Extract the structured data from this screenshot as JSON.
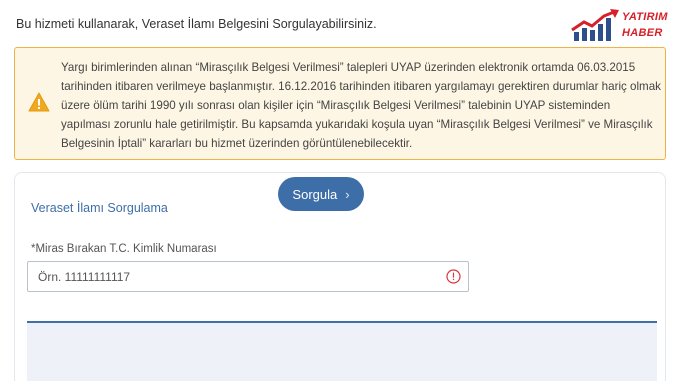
{
  "intro_text": "Bu hizmeti kullanarak, Veraset İlamı Belgesini Sorgulayabilirsiniz.",
  "logo": {
    "line1": "YATIRIM",
    "line2": "HABER",
    "color": "#d6202a"
  },
  "warning": {
    "icon": "warning-triangle-icon",
    "text": "Yargı birimlerinden alınan “Mirasçılık Belgesi Verilmesi” talepleri UYAP üzerinden elektronik ortamda 06.03.2015 tarihinden itibaren verilmeye başlanmıştır. 16.12.2016 tarihinden itibaren yargılamayı gerektiren durumlar hariç olmak üzere ölüm tarihi 1990 yılı sonrası olan kişiler için “Mirasçılık Belgesi Verilmesi” talebinin UYAP sisteminden yapılması zorunlu hale getirilmiştir. Bu kapsamda yukarıdaki koşula uyan “Mirasçılık Belgesi Verilmesi” ve Mirasçılık Belgesinin İptali” kararları bu hizmet üzerinden görüntülenebilecektir.",
    "border_color": "#f0b446",
    "bg_color": "#fdf6e4"
  },
  "form": {
    "title": "Veraset İlamı Sorgulama",
    "field_label": "*Miras Bırakan T.C. Kimlik Numarası",
    "field_placeholder": "Örn. 11111111117",
    "field_value": "",
    "submit_label": "Sorgula",
    "accent_color": "#3d6ea8"
  }
}
